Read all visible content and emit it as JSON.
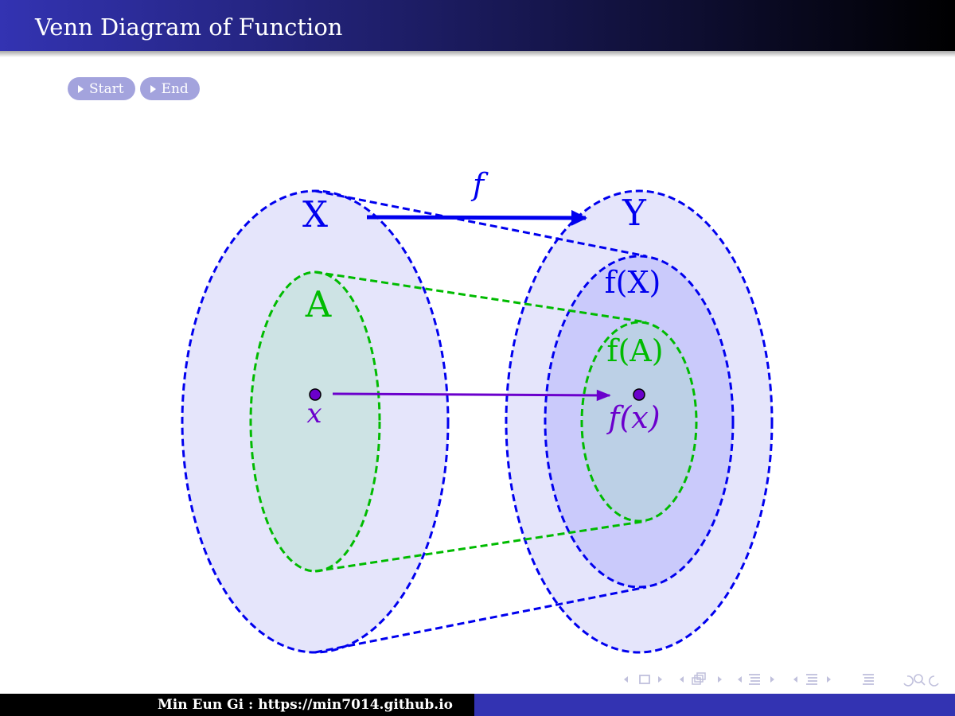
{
  "header": {
    "title": "Venn Diagram of Function"
  },
  "nav_buttons": {
    "start_label": "Start",
    "end_label": "End"
  },
  "diagram": {
    "function_label": "f",
    "domain_label": "X",
    "codomain_label": "Y",
    "subset_label": "A",
    "image_of_domain_label": "f(X)",
    "image_of_subset_label": "f(A)",
    "element_label": "x",
    "element_image_label": "f(x)",
    "colors": {
      "set_outline": "#0000ee",
      "set_fill": "#e5e5fb",
      "image_fill": "#cacafb",
      "subset_outline": "#00bb00",
      "subset_fill": "#cde3e4",
      "subset_image_fill": "#bcd0e6",
      "element": "#6b00cc"
    }
  },
  "beamer_navigation": {
    "icons": [
      "frame-prev-icon",
      "frame-icon",
      "frame-next-icon",
      "subsection-prev-icon",
      "subsection-icon",
      "subsection-next-icon",
      "section-prev-icon",
      "section-icon",
      "section-next-icon",
      "subsubsection-prev-icon",
      "subsubsection-icon",
      "subsubsection-next-icon",
      "toc-icon",
      "undo-icon",
      "search-icon",
      "redo-icon"
    ]
  },
  "footer": {
    "author": "Min Eun Gi : https://min7014.github.io"
  }
}
